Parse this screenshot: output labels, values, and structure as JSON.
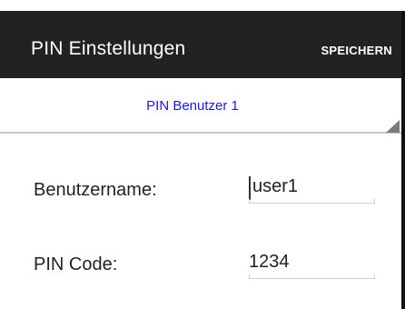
{
  "action_bar": {
    "title": "PIN Einstellungen",
    "save_label": "SPEICHERN"
  },
  "spinner": {
    "selected": "PIN Benutzer 1",
    "icon": "dropdown-triangle-icon",
    "accent": "#1a1adc"
  },
  "form": {
    "username": {
      "label": "Benutzername:",
      "value": "user1"
    },
    "pin": {
      "label": "PIN Code:",
      "value": "1234"
    }
  },
  "colors": {
    "action_bar_bg": "#222222",
    "text": "#222222",
    "divider": "#c8c8c8"
  }
}
